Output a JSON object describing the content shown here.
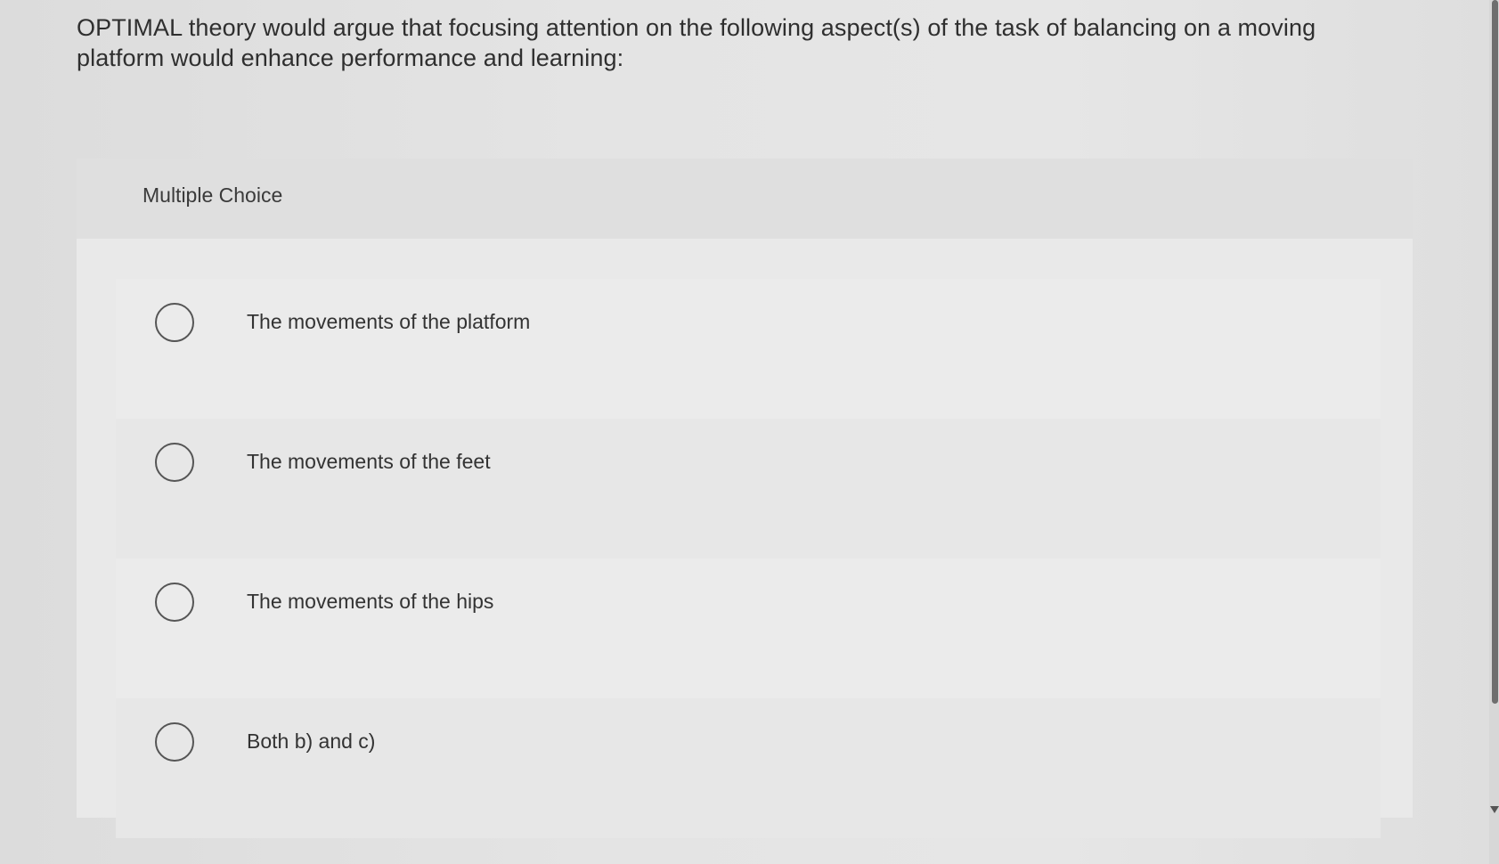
{
  "question": {
    "text": "OPTIMAL theory would argue that focusing attention on the following aspect(s) of the task of balancing on a moving platform would enhance performance and learning:"
  },
  "multiple_choice": {
    "header_label": "Multiple Choice",
    "options": [
      {
        "label": "The movements of the platform",
        "selected": false
      },
      {
        "label": "The movements of the feet",
        "selected": false
      },
      {
        "label": "The movements of the hips",
        "selected": false
      },
      {
        "label": "Both b) and c)",
        "selected": false
      }
    ]
  },
  "scrollbar": {
    "arrow_icon": "chevron-down-icon"
  }
}
